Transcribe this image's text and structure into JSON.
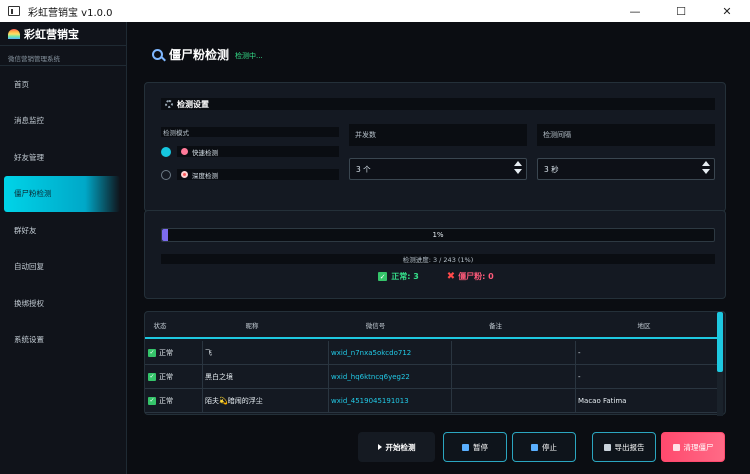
{
  "window": {
    "title": "彩虹营销宝 v1.0.0",
    "minimize": "—",
    "maximize": "☐",
    "close": "✕"
  },
  "sidebar": {
    "brand": "彩虹营销宝",
    "subtitle": "微信营销管理系统",
    "items": [
      {
        "label": "首页"
      },
      {
        "label": "消息监控"
      },
      {
        "label": "好友管理"
      },
      {
        "label": "僵尸粉检测",
        "active": true
      },
      {
        "label": "群好友"
      },
      {
        "label": "自动回复"
      },
      {
        "label": "换绑授权"
      },
      {
        "label": "系统设置"
      }
    ]
  },
  "header": {
    "title": "僵尸粉检测",
    "status": "检测中..."
  },
  "settings": {
    "section_title": "检测设置",
    "mode_label": "检测模式",
    "modes": [
      {
        "label": "快速检测",
        "selected": true
      },
      {
        "label": "深度检测",
        "selected": false
      }
    ],
    "concurrency_label": "并发数",
    "concurrency_value": "3 个",
    "interval_label": "检测间隔",
    "interval_value": "3 秒"
  },
  "progress": {
    "percent_text": "1%",
    "fraction": 0.01,
    "detail": "检测进度: 3 / 243 (1%)",
    "normal_label": "正常: 3",
    "zombie_label": "僵尸粉: 0"
  },
  "table": {
    "columns": [
      "状态",
      "昵称",
      "微信号",
      "备注",
      "地区"
    ],
    "rows": [
      {
        "status": "正常",
        "nickname": "飞",
        "wxid": "wxid_n7nxa5okcdo712",
        "note": "",
        "region": "-"
      },
      {
        "status": "正常",
        "nickname": "黑白之境",
        "wxid": "wxid_hq6ktncq6yeg22",
        "note": "",
        "region": "-"
      },
      {
        "status": "正常",
        "nickname": "陌夫💫暗闹的浮尘",
        "wxid": "wxid_4519045191013",
        "note": "",
        "region": "Macao Fatima"
      }
    ]
  },
  "actions": {
    "start": "开始检测",
    "pause": "暂停",
    "stop": "停止",
    "export": "导出报告",
    "clear": "清理僵尸"
  },
  "colors": {
    "accent": "#16c7e0",
    "ok": "#35e08a",
    "danger": "#ff4a6e",
    "progress": "#7c6cf0"
  }
}
